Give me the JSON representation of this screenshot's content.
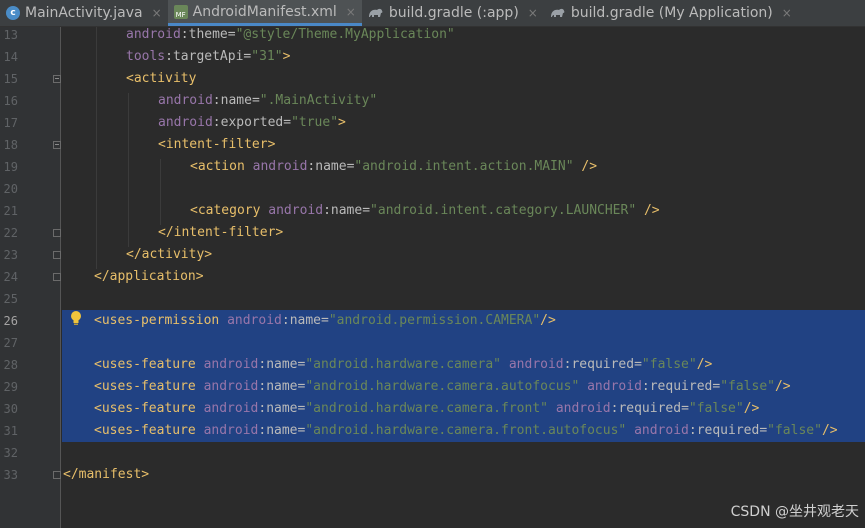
{
  "tabs": [
    {
      "name": "MainActivity.java",
      "icon": "java-class-icon",
      "active": false
    },
    {
      "name": "AndroidManifest.xml",
      "icon": "manifest-icon",
      "active": true
    },
    {
      "name": "build.gradle (:app)",
      "icon": "gradle-icon",
      "active": false
    },
    {
      "name": "build.gradle (My Application)",
      "icon": "gradle-icon",
      "active": false
    }
  ],
  "tab_close_glyph": "×",
  "editor": {
    "current_line": "26",
    "lines": [
      {
        "n": "13",
        "tokens": [
          [
            "ns",
            "android"
          ],
          [
            "punc",
            ":"
          ],
          [
            "attr",
            "theme"
          ],
          [
            "punc",
            "="
          ],
          [
            "val",
            "\"@style/Theme.MyApplication\""
          ]
        ]
      },
      {
        "n": "14",
        "tokens": [
          [
            "ns",
            "tools"
          ],
          [
            "punc",
            ":"
          ],
          [
            "attr",
            "targetApi"
          ],
          [
            "punc",
            "="
          ],
          [
            "val",
            "\"31\""
          ],
          [
            "tag",
            ">"
          ]
        ]
      },
      {
        "n": "15",
        "tokens": [
          [
            "tag",
            "<activity"
          ]
        ]
      },
      {
        "n": "16",
        "tokens": [
          [
            "ns",
            "android"
          ],
          [
            "punc",
            ":"
          ],
          [
            "attr",
            "name"
          ],
          [
            "punc",
            "="
          ],
          [
            "val",
            "\".MainActivity\""
          ]
        ]
      },
      {
        "n": "17",
        "tokens": [
          [
            "ns",
            "android"
          ],
          [
            "punc",
            ":"
          ],
          [
            "attr",
            "exported"
          ],
          [
            "punc",
            "="
          ],
          [
            "val",
            "\"true\""
          ],
          [
            "tag",
            ">"
          ]
        ]
      },
      {
        "n": "18",
        "tokens": [
          [
            "tag",
            "<intent-filter>"
          ]
        ]
      },
      {
        "n": "19",
        "tokens": [
          [
            "tag",
            "<action "
          ],
          [
            "ns",
            "android"
          ],
          [
            "punc",
            ":"
          ],
          [
            "attr",
            "name"
          ],
          [
            "punc",
            "="
          ],
          [
            "val",
            "\"android.intent.action.MAIN\""
          ],
          [
            "tag",
            " />"
          ]
        ]
      },
      {
        "n": "20",
        "tokens": []
      },
      {
        "n": "21",
        "tokens": [
          [
            "tag",
            "<category "
          ],
          [
            "ns",
            "android"
          ],
          [
            "punc",
            ":"
          ],
          [
            "attr",
            "name"
          ],
          [
            "punc",
            "="
          ],
          [
            "val",
            "\"android.intent.category.LAUNCHER\""
          ],
          [
            "tag",
            " />"
          ]
        ]
      },
      {
        "n": "22",
        "tokens": [
          [
            "tag",
            "</intent-filter>"
          ]
        ]
      },
      {
        "n": "23",
        "tokens": [
          [
            "tag",
            "</activity>"
          ]
        ]
      },
      {
        "n": "24",
        "tokens": [
          [
            "tag",
            "</application>"
          ]
        ]
      },
      {
        "n": "25",
        "tokens": []
      },
      {
        "n": "26",
        "tokens": [
          [
            "tag",
            "<uses-permission "
          ],
          [
            "ns",
            "android"
          ],
          [
            "punc",
            ":"
          ],
          [
            "attr",
            "name"
          ],
          [
            "punc",
            "="
          ],
          [
            "val",
            "\"android.permission.CAMERA\""
          ],
          [
            "tag",
            "/>"
          ]
        ]
      },
      {
        "n": "27",
        "tokens": []
      },
      {
        "n": "28",
        "tokens": [
          [
            "tag",
            "<uses-feature "
          ],
          [
            "ns",
            "android"
          ],
          [
            "punc",
            ":"
          ],
          [
            "attr",
            "name"
          ],
          [
            "punc",
            "="
          ],
          [
            "val",
            "\"android.hardware.camera\""
          ],
          [
            "punc",
            " "
          ],
          [
            "ns",
            "android"
          ],
          [
            "punc",
            ":"
          ],
          [
            "attr",
            "required"
          ],
          [
            "punc",
            "="
          ],
          [
            "val",
            "\"false\""
          ],
          [
            "tag",
            "/>"
          ]
        ]
      },
      {
        "n": "29",
        "tokens": [
          [
            "tag",
            "<uses-feature "
          ],
          [
            "ns",
            "android"
          ],
          [
            "punc",
            ":"
          ],
          [
            "attr",
            "name"
          ],
          [
            "punc",
            "="
          ],
          [
            "val",
            "\"android.hardware.camera.autofocus\""
          ],
          [
            "punc",
            " "
          ],
          [
            "ns",
            "android"
          ],
          [
            "punc",
            ":"
          ],
          [
            "attr",
            "required"
          ],
          [
            "punc",
            "="
          ],
          [
            "val",
            "\"false\""
          ],
          [
            "tag",
            "/>"
          ]
        ]
      },
      {
        "n": "30",
        "tokens": [
          [
            "tag",
            "<uses-feature "
          ],
          [
            "ns",
            "android"
          ],
          [
            "punc",
            ":"
          ],
          [
            "attr",
            "name"
          ],
          [
            "punc",
            "="
          ],
          [
            "val",
            "\"android.hardware.camera.front\""
          ],
          [
            "punc",
            " "
          ],
          [
            "ns",
            "android"
          ],
          [
            "punc",
            ":"
          ],
          [
            "attr",
            "required"
          ],
          [
            "punc",
            "="
          ],
          [
            "val",
            "\"false\""
          ],
          [
            "tag",
            "/>"
          ]
        ]
      },
      {
        "n": "31",
        "tokens": [
          [
            "tag",
            "<uses-feature "
          ],
          [
            "ns",
            "android"
          ],
          [
            "punc",
            ":"
          ],
          [
            "attr",
            "name"
          ],
          [
            "punc",
            "="
          ],
          [
            "val",
            "\"android.hardware.camera.front.autofocus\""
          ],
          [
            "punc",
            " "
          ],
          [
            "ns",
            "android"
          ],
          [
            "punc",
            ":"
          ],
          [
            "attr",
            "required"
          ],
          [
            "punc",
            "="
          ],
          [
            "val",
            "\"false\""
          ],
          [
            "tag",
            "/>"
          ]
        ]
      },
      {
        "n": "32",
        "tokens": []
      },
      {
        "n": "33",
        "tokens": [
          [
            "tag",
            "</manifest>"
          ]
        ]
      }
    ]
  },
  "watermark": "CSDN @坐井观老天",
  "colors": {
    "background": "#2b2b2b",
    "selection": "#214283",
    "tag": "#e8bf6a",
    "namespace": "#9876aa",
    "attribute": "#bababa",
    "value": "#6a8759"
  }
}
